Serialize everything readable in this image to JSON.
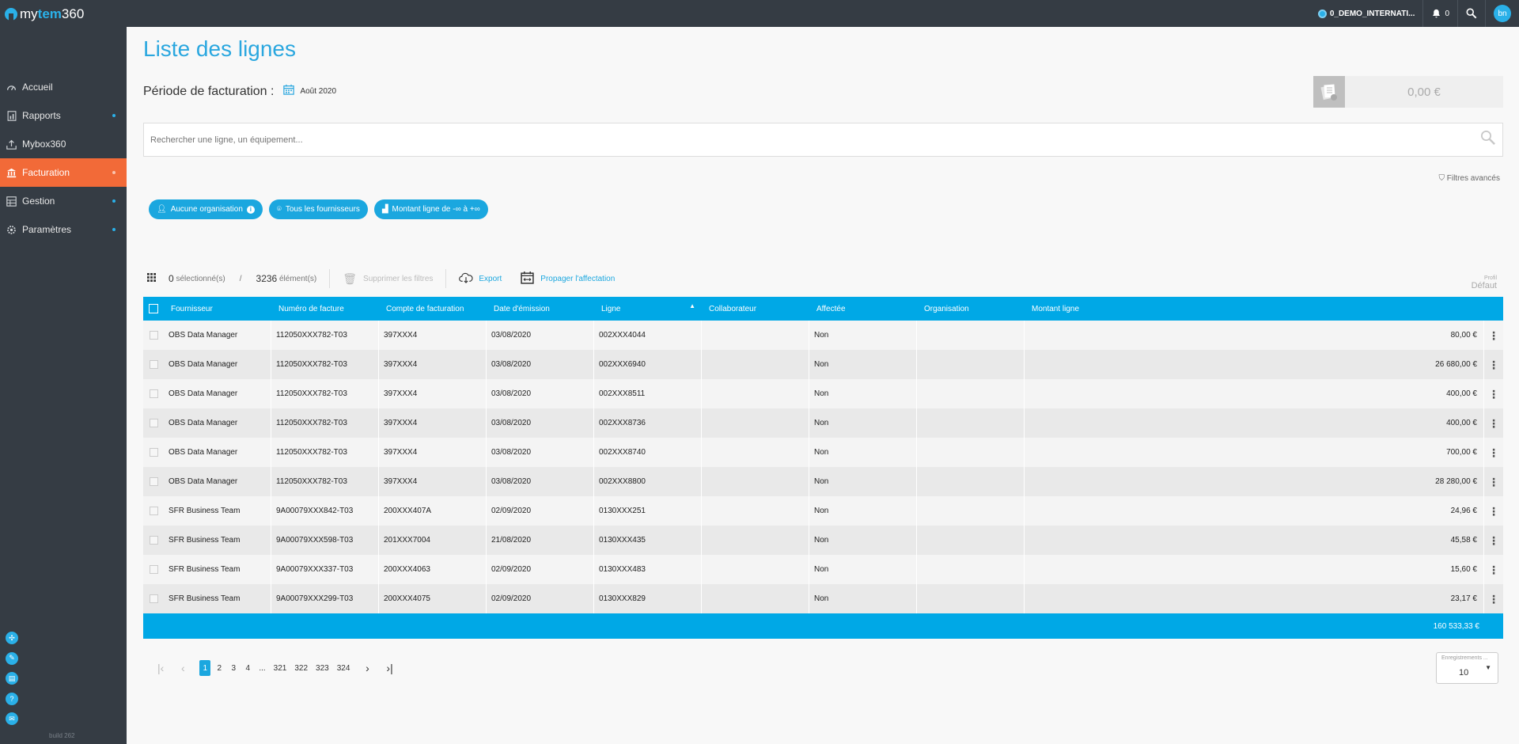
{
  "app": {
    "logo": {
      "part1": "my",
      "part2": "tem",
      "part3": "360"
    },
    "org_name": "0_DEMO_INTERNATI...",
    "notif_count": "0",
    "user_initials": "bn",
    "build": "build 262"
  },
  "sidebar": {
    "items": [
      {
        "label": "Accueil",
        "icon": "gauge-icon"
      },
      {
        "label": "Rapports",
        "icon": "report-icon"
      },
      {
        "label": "Mybox360",
        "icon": "upload-icon"
      },
      {
        "label": "Facturation",
        "icon": "bank-icon"
      },
      {
        "label": "Gestion",
        "icon": "grid-icon"
      },
      {
        "label": "Paramètres",
        "icon": "gear-icon"
      }
    ],
    "active": "Facturation",
    "bottom_icons": [
      "network-icon",
      "pen-icon",
      "file-icon",
      "help-icon",
      "mail-icon"
    ]
  },
  "page": {
    "title": "Liste des lignes",
    "period_label": "Période de facturation :",
    "period_value": "Août 2020",
    "total_amount": "0,00 €",
    "search_placeholder": "Rechercher une ligne, un équipement...",
    "advanced_filters": "Filtres avancés"
  },
  "chips": [
    {
      "label": "Aucune organisation"
    },
    {
      "label": "Tous les fournisseurs"
    },
    {
      "label": "Montant ligne de -∞ à +∞"
    }
  ],
  "toolbar": {
    "selected_count": "0",
    "selected_label": "sélectionné(s)",
    "slash": "/",
    "total_count": "3236",
    "total_label": "élément(s)",
    "clear_filters": "Supprimer les filtres",
    "export": "Export",
    "propagate": "Propager l'affectation",
    "profile_label": "Profil",
    "profile_value": "Défaut"
  },
  "table": {
    "columns": [
      "Fournisseur",
      "Numéro de facture",
      "Compte de facturation",
      "Date d'émission",
      "Ligne",
      "Collaborateur",
      "Affectée",
      "Organisation",
      "Montant ligne"
    ],
    "rows": [
      [
        "OBS Data Manager",
        "112050XXX782-T03",
        "397XXX4",
        "03/08/2020",
        "002XXX4044",
        "",
        "Non",
        "",
        "80,00 €"
      ],
      [
        "OBS Data Manager",
        "112050XXX782-T03",
        "397XXX4",
        "03/08/2020",
        "002XXX6940",
        "",
        "Non",
        "",
        "26 680,00 €"
      ],
      [
        "OBS Data Manager",
        "112050XXX782-T03",
        "397XXX4",
        "03/08/2020",
        "002XXX8511",
        "",
        "Non",
        "",
        "400,00 €"
      ],
      [
        "OBS Data Manager",
        "112050XXX782-T03",
        "397XXX4",
        "03/08/2020",
        "002XXX8736",
        "",
        "Non",
        "",
        "400,00 €"
      ],
      [
        "OBS Data Manager",
        "112050XXX782-T03",
        "397XXX4",
        "03/08/2020",
        "002XXX8740",
        "",
        "Non",
        "",
        "700,00 €"
      ],
      [
        "OBS Data Manager",
        "112050XXX782-T03",
        "397XXX4",
        "03/08/2020",
        "002XXX8800",
        "",
        "Non",
        "",
        "28 280,00 €"
      ],
      [
        "SFR Business Team",
        "9A00079XXX842-T03",
        "200XXX407A",
        "02/09/2020",
        "0130XXX251",
        "",
        "Non",
        "",
        "24,96 €"
      ],
      [
        "SFR Business Team",
        "9A00079XXX598-T03",
        "201XXX7004",
        "21/08/2020",
        "0130XXX435",
        "",
        "Non",
        "",
        "45,58 €"
      ],
      [
        "SFR Business Team",
        "9A00079XXX337-T03",
        "200XXX4063",
        "02/09/2020",
        "0130XXX483",
        "",
        "Non",
        "",
        "15,60 €"
      ],
      [
        "SFR Business Team",
        "9A00079XXX299-T03",
        "200XXX4075",
        "02/09/2020",
        "0130XXX829",
        "",
        "Non",
        "",
        "23,17 €"
      ]
    ],
    "total": "160 533,33 €"
  },
  "pagination": {
    "pages": [
      "1",
      "2",
      "3",
      "4",
      "...",
      "321",
      "322",
      "323",
      "324"
    ],
    "current": "1",
    "per_page_label": "Enregistrements ...",
    "per_page": "10"
  },
  "colors": {
    "accent": "#1ba7df",
    "active_nav": "#f26a38",
    "sidebar": "#353c44"
  }
}
